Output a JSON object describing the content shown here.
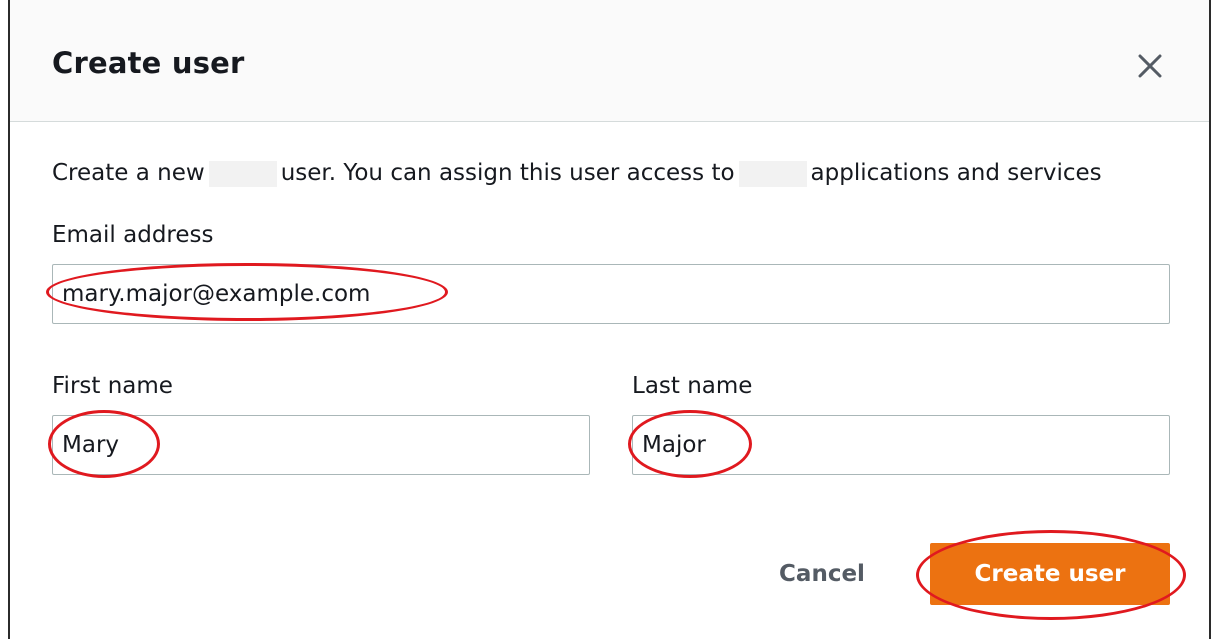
{
  "dialog": {
    "title": "Create user",
    "close_icon": "close-icon"
  },
  "description": {
    "part1": "Create a new",
    "part2": "user. You can assign this user access to",
    "part3": "applications and services"
  },
  "email": {
    "label": "Email address",
    "value": "mary.major@example.com"
  },
  "first_name": {
    "label": "First name",
    "value": "Mary"
  },
  "last_name": {
    "label": "Last name",
    "value": "Major"
  },
  "actions": {
    "cancel_label": "Cancel",
    "create_label": "Create user"
  },
  "colors": {
    "primary_button": "#ec7211",
    "annotation": "#e0191f"
  }
}
